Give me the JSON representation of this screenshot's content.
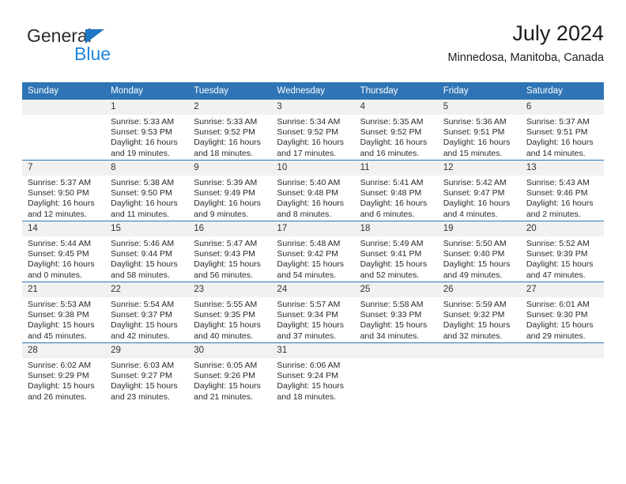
{
  "brand": {
    "name_top": "General",
    "name_bottom": "Blue"
  },
  "header": {
    "title": "July 2024",
    "subtitle": "Minnedosa, Manitoba, Canada"
  },
  "colors": {
    "header_blue": "#2f75b5",
    "logo_blue": "#1f87dd",
    "daynum_bg": "#f1f1f1"
  },
  "weekday_headers": [
    "Sunday",
    "Monday",
    "Tuesday",
    "Wednesday",
    "Thursday",
    "Friday",
    "Saturday"
  ],
  "weeks": [
    [
      {
        "day": "",
        "lines": []
      },
      {
        "day": "1",
        "lines": [
          "Sunrise: 5:33 AM",
          "Sunset: 9:53 PM",
          "Daylight: 16 hours",
          "and 19 minutes."
        ]
      },
      {
        "day": "2",
        "lines": [
          "Sunrise: 5:33 AM",
          "Sunset: 9:52 PM",
          "Daylight: 16 hours",
          "and 18 minutes."
        ]
      },
      {
        "day": "3",
        "lines": [
          "Sunrise: 5:34 AM",
          "Sunset: 9:52 PM",
          "Daylight: 16 hours",
          "and 17 minutes."
        ]
      },
      {
        "day": "4",
        "lines": [
          "Sunrise: 5:35 AM",
          "Sunset: 9:52 PM",
          "Daylight: 16 hours",
          "and 16 minutes."
        ]
      },
      {
        "day": "5",
        "lines": [
          "Sunrise: 5:36 AM",
          "Sunset: 9:51 PM",
          "Daylight: 16 hours",
          "and 15 minutes."
        ]
      },
      {
        "day": "6",
        "lines": [
          "Sunrise: 5:37 AM",
          "Sunset: 9:51 PM",
          "Daylight: 16 hours",
          "and 14 minutes."
        ]
      }
    ],
    [
      {
        "day": "7",
        "lines": [
          "Sunrise: 5:37 AM",
          "Sunset: 9:50 PM",
          "Daylight: 16 hours",
          "and 12 minutes."
        ]
      },
      {
        "day": "8",
        "lines": [
          "Sunrise: 5:38 AM",
          "Sunset: 9:50 PM",
          "Daylight: 16 hours",
          "and 11 minutes."
        ]
      },
      {
        "day": "9",
        "lines": [
          "Sunrise: 5:39 AM",
          "Sunset: 9:49 PM",
          "Daylight: 16 hours",
          "and 9 minutes."
        ]
      },
      {
        "day": "10",
        "lines": [
          "Sunrise: 5:40 AM",
          "Sunset: 9:48 PM",
          "Daylight: 16 hours",
          "and 8 minutes."
        ]
      },
      {
        "day": "11",
        "lines": [
          "Sunrise: 5:41 AM",
          "Sunset: 9:48 PM",
          "Daylight: 16 hours",
          "and 6 minutes."
        ]
      },
      {
        "day": "12",
        "lines": [
          "Sunrise: 5:42 AM",
          "Sunset: 9:47 PM",
          "Daylight: 16 hours",
          "and 4 minutes."
        ]
      },
      {
        "day": "13",
        "lines": [
          "Sunrise: 5:43 AM",
          "Sunset: 9:46 PM",
          "Daylight: 16 hours",
          "and 2 minutes."
        ]
      }
    ],
    [
      {
        "day": "14",
        "lines": [
          "Sunrise: 5:44 AM",
          "Sunset: 9:45 PM",
          "Daylight: 16 hours",
          "and 0 minutes."
        ]
      },
      {
        "day": "15",
        "lines": [
          "Sunrise: 5:46 AM",
          "Sunset: 9:44 PM",
          "Daylight: 15 hours",
          "and 58 minutes."
        ]
      },
      {
        "day": "16",
        "lines": [
          "Sunrise: 5:47 AM",
          "Sunset: 9:43 PM",
          "Daylight: 15 hours",
          "and 56 minutes."
        ]
      },
      {
        "day": "17",
        "lines": [
          "Sunrise: 5:48 AM",
          "Sunset: 9:42 PM",
          "Daylight: 15 hours",
          "and 54 minutes."
        ]
      },
      {
        "day": "18",
        "lines": [
          "Sunrise: 5:49 AM",
          "Sunset: 9:41 PM",
          "Daylight: 15 hours",
          "and 52 minutes."
        ]
      },
      {
        "day": "19",
        "lines": [
          "Sunrise: 5:50 AM",
          "Sunset: 9:40 PM",
          "Daylight: 15 hours",
          "and 49 minutes."
        ]
      },
      {
        "day": "20",
        "lines": [
          "Sunrise: 5:52 AM",
          "Sunset: 9:39 PM",
          "Daylight: 15 hours",
          "and 47 minutes."
        ]
      }
    ],
    [
      {
        "day": "21",
        "lines": [
          "Sunrise: 5:53 AM",
          "Sunset: 9:38 PM",
          "Daylight: 15 hours",
          "and 45 minutes."
        ]
      },
      {
        "day": "22",
        "lines": [
          "Sunrise: 5:54 AM",
          "Sunset: 9:37 PM",
          "Daylight: 15 hours",
          "and 42 minutes."
        ]
      },
      {
        "day": "23",
        "lines": [
          "Sunrise: 5:55 AM",
          "Sunset: 9:35 PM",
          "Daylight: 15 hours",
          "and 40 minutes."
        ]
      },
      {
        "day": "24",
        "lines": [
          "Sunrise: 5:57 AM",
          "Sunset: 9:34 PM",
          "Daylight: 15 hours",
          "and 37 minutes."
        ]
      },
      {
        "day": "25",
        "lines": [
          "Sunrise: 5:58 AM",
          "Sunset: 9:33 PM",
          "Daylight: 15 hours",
          "and 34 minutes."
        ]
      },
      {
        "day": "26",
        "lines": [
          "Sunrise: 5:59 AM",
          "Sunset: 9:32 PM",
          "Daylight: 15 hours",
          "and 32 minutes."
        ]
      },
      {
        "day": "27",
        "lines": [
          "Sunrise: 6:01 AM",
          "Sunset: 9:30 PM",
          "Daylight: 15 hours",
          "and 29 minutes."
        ]
      }
    ],
    [
      {
        "day": "28",
        "lines": [
          "Sunrise: 6:02 AM",
          "Sunset: 9:29 PM",
          "Daylight: 15 hours",
          "and 26 minutes."
        ]
      },
      {
        "day": "29",
        "lines": [
          "Sunrise: 6:03 AM",
          "Sunset: 9:27 PM",
          "Daylight: 15 hours",
          "and 23 minutes."
        ]
      },
      {
        "day": "30",
        "lines": [
          "Sunrise: 6:05 AM",
          "Sunset: 9:26 PM",
          "Daylight: 15 hours",
          "and 21 minutes."
        ]
      },
      {
        "day": "31",
        "lines": [
          "Sunrise: 6:06 AM",
          "Sunset: 9:24 PM",
          "Daylight: 15 hours",
          "and 18 minutes."
        ]
      },
      {
        "day": "",
        "lines": []
      },
      {
        "day": "",
        "lines": []
      },
      {
        "day": "",
        "lines": []
      }
    ]
  ]
}
